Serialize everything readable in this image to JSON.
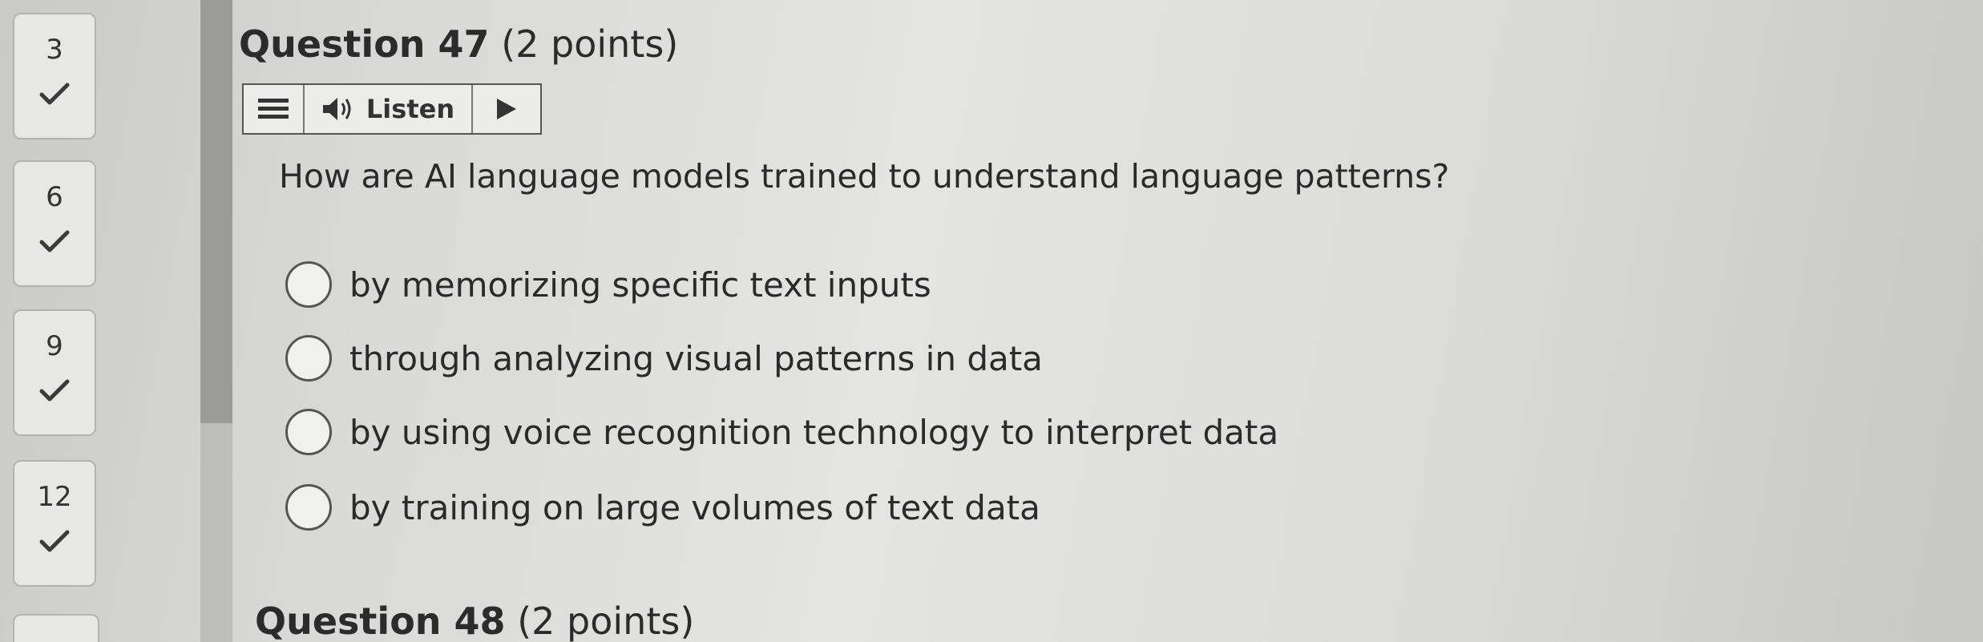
{
  "nav": {
    "questions": [
      {
        "number": "3",
        "status": "answered"
      },
      {
        "number": "6",
        "status": "answered"
      },
      {
        "number": "9",
        "status": "answered"
      },
      {
        "number": "12",
        "status": "answered"
      }
    ]
  },
  "question": {
    "title": "Question 47",
    "points": "(2 points)",
    "text": "How are AI language models trained to understand language patterns?",
    "options": [
      "by memorizing specific text inputs",
      "through analyzing visual patterns in data",
      "by using voice recognition technology to interpret data",
      "by training on large volumes of text data"
    ]
  },
  "listen_bar": {
    "label": "Listen",
    "icons": [
      "menu-icon",
      "speaker-icon",
      "play-icon"
    ]
  },
  "next_question": {
    "title": "Question 48",
    "points": "(2 points)"
  },
  "colors": {
    "background": "#dcdcda",
    "text": "#2b2b2b",
    "check": "#3a3a3a"
  }
}
